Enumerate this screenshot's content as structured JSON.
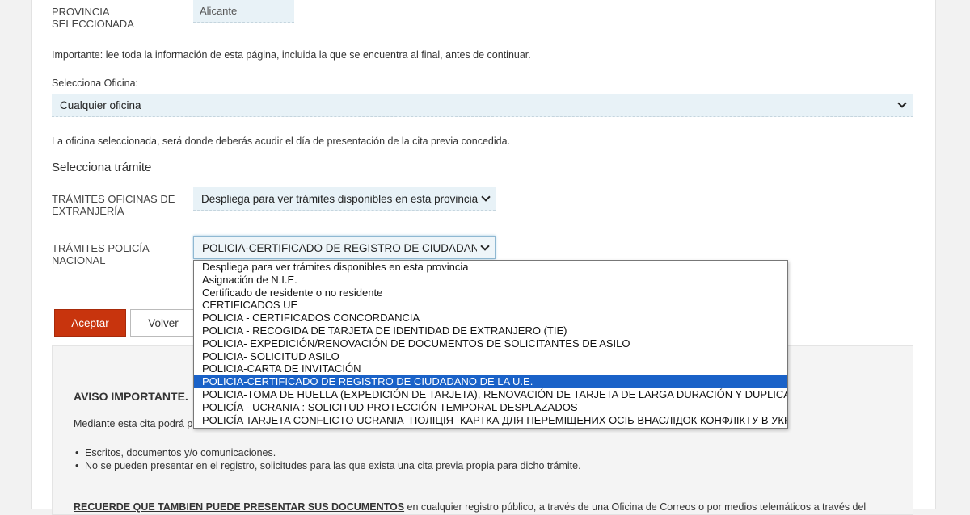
{
  "province": {
    "label_line1": "PROVINCIA",
    "label_line2": "SELECCIONADA",
    "value": "Alicante"
  },
  "important_note": "Importante: lee toda la información de esta página, incluida la que se encuentra al final, antes de continuar.",
  "office": {
    "label": "Selecciona Oficina:",
    "value": "Cualquier oficina",
    "help": "La oficina seleccionada, será donde deberás acudir el día de presentación de la cita previa concedida."
  },
  "procedure_heading": "Selecciona trámite",
  "extranjeria": {
    "label_line1": "TRÁMITES OFICINAS DE",
    "label_line2": "EXTRANJERÍA",
    "value": "Despliega para ver trámites disponibles en esta provincia"
  },
  "policia": {
    "label_line1": "TRÁMITES POLICÍA",
    "label_line2": "NACIONAL",
    "value": "POLICIA-CERTIFICADO DE REGISTRO DE CIUDADANO DE"
  },
  "dropdown": {
    "options": [
      "Despliega para ver trámites disponibles en esta provincia",
      "Asignación de N.I.E.",
      "Certificado de residente o no residente",
      "CERTIFICADOS UE",
      "POLICIA - CERTIFICADOS CONCORDANCIA",
      "POLICIA - RECOGIDA DE TARJETA DE IDENTIDAD DE EXTRANJERO (TIE)",
      "POLICIA- EXPEDICIÓN/RENOVACIÓN DE DOCUMENTOS DE SOLICITANTES DE ASILO",
      "POLICIA- SOLICITUD ASILO",
      "POLICIA-CARTA DE INVITACIÓN",
      "POLICIA-CERTIFICADO DE REGISTRO DE CIUDADANO DE LA U.E.",
      "POLICIA-TOMA DE HUELLA (EXPEDICIÓN DE TARJETA), RENOVACIÓN DE TARJETA DE LARGA DURACIÓN Y DUPLICADO",
      "POLICÍA - UCRANIA : SOLICITUD PROTECCIÓN TEMPORAL DESPLAZADOS",
      "POLICÍA TARJETA CONFLICTO UCRANIA–ПОЛІЦІЯ -КАРТКА ДЛЯ ПЕРЕМІЩЕНИХ ОСІБ ВНАСЛІДОК КОНФЛІКТУ В УКРАЇНІ"
    ],
    "selected_index": 9
  },
  "buttons": {
    "accept": "Aceptar",
    "back": "Volver"
  },
  "notice": {
    "title": "AVISO IMPORTANTE.",
    "intro": "Mediante esta cita podrá p",
    "bullets": [
      "Escritos, documentos y/o comunicaciones.",
      "No se pueden presentar en el registro, solicitudes para las que exista una cita previa propia para dicho trámite."
    ],
    "footer_bold": "RECUERDE QUE TAMBIEN PUEDE PRESENTAR SUS DOCUMENTOS",
    "footer_rest": " en cualquier registro público, a través de una Oficina de Correos o por medios telemáticos a través del"
  },
  "colors": {
    "accent": "#c8340d",
    "warning_text": "#8a2a12",
    "field_bg": "#e8f2f7",
    "selected_option": "#1a62c8"
  }
}
